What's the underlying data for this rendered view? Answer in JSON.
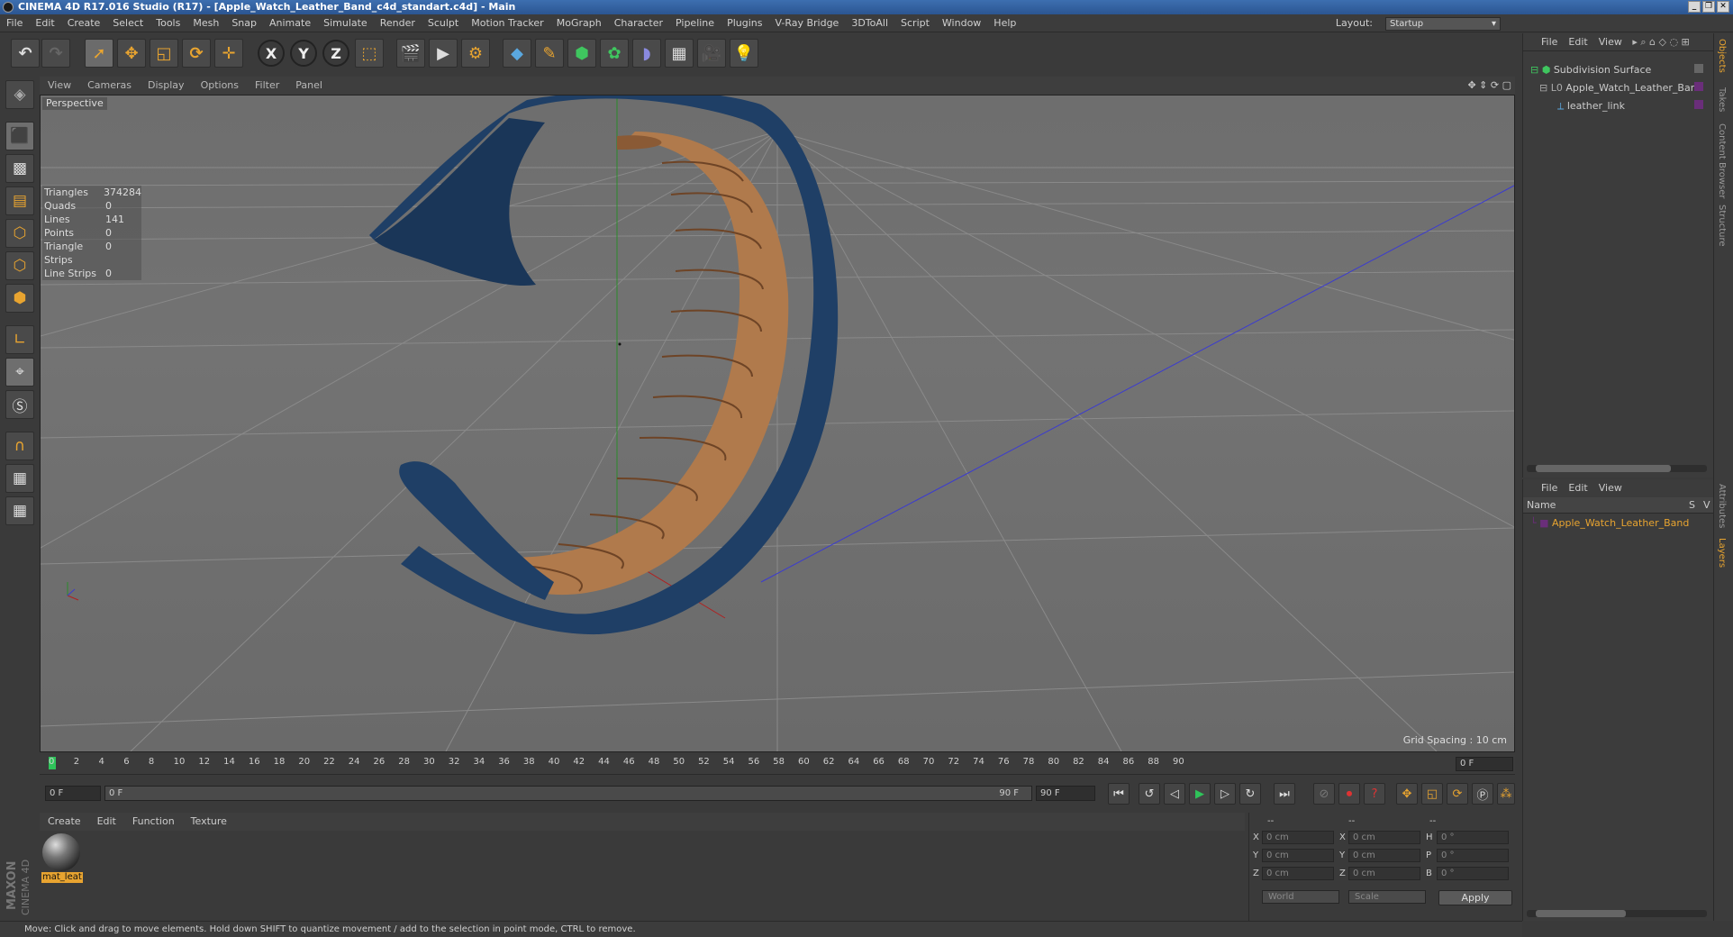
{
  "window": {
    "title": "CINEMA 4D R17.016 Studio (R17) - [Apple_Watch_Leather_Band_c4d_standart.c4d] - Main"
  },
  "menu": [
    "File",
    "Edit",
    "Create",
    "Select",
    "Tools",
    "Mesh",
    "Snap",
    "Animate",
    "Simulate",
    "Render",
    "Sculpt",
    "Motion Tracker",
    "MoGraph",
    "Character",
    "Pipeline",
    "Plugins",
    "V-Ray Bridge",
    "3DToAll",
    "Script",
    "Window",
    "Help"
  ],
  "layout": {
    "label": "Layout:",
    "value": "Startup"
  },
  "toolbar": {
    "x_label": "X",
    "y_label": "Y",
    "z_label": "Z"
  },
  "viewport": {
    "menu": [
      "View",
      "Cameras",
      "Display",
      "Options",
      "Filter",
      "Panel"
    ],
    "label": "Perspective",
    "grid_spacing": "Grid Spacing : 10 cm",
    "stats": [
      {
        "k": "Triangles",
        "v": "374284"
      },
      {
        "k": "Quads",
        "v": "0"
      },
      {
        "k": "Lines",
        "v": "141"
      },
      {
        "k": "Points",
        "v": "0"
      },
      {
        "k": "Triangle Strips",
        "v": "0"
      },
      {
        "k": "Line Strips",
        "v": "0"
      }
    ]
  },
  "timeline": {
    "ticks": [
      "0",
      "2",
      "4",
      "6",
      "8",
      "10",
      "12",
      "14",
      "16",
      "18",
      "20",
      "22",
      "24",
      "26",
      "28",
      "30",
      "32",
      "34",
      "36",
      "38",
      "40",
      "42",
      "44",
      "46",
      "48",
      "50",
      "52",
      "54",
      "56",
      "58",
      "60",
      "62",
      "64",
      "66",
      "68",
      "70",
      "72",
      "74",
      "76",
      "78",
      "80",
      "82",
      "84",
      "86",
      "88",
      "90"
    ],
    "current_frame": "0 F",
    "start_field": "0 F",
    "slider_start": "0 F",
    "slider_end": "90 F",
    "end_field": "90 F"
  },
  "materials": {
    "menu": [
      "Create",
      "Edit",
      "Function",
      "Texture"
    ],
    "items": [
      {
        "name": "mat_leat"
      }
    ]
  },
  "coords": {
    "headers": [
      "--",
      "--",
      "--"
    ],
    "rows": [
      {
        "a": "X",
        "av": "0 cm",
        "b": "X",
        "bv": "0 cm",
        "c": "H",
        "cv": "0 °"
      },
      {
        "a": "Y",
        "av": "0 cm",
        "b": "Y",
        "bv": "0 cm",
        "c": "P",
        "cv": "0 °"
      },
      {
        "a": "Z",
        "av": "0 cm",
        "b": "Z",
        "bv": "0 cm",
        "c": "B",
        "cv": "0 °"
      }
    ],
    "world": "World",
    "scale": "Scale",
    "apply": "Apply"
  },
  "status": "Move: Click and drag to move elements. Hold down SHIFT to quantize movement / add to the selection in point mode, CTRL to remove.",
  "objects": {
    "menu": [
      "File",
      "Edit",
      "View"
    ],
    "tree": [
      {
        "name": "Subdivision Surface"
      },
      {
        "name": "Apple_Watch_Leather_Band"
      },
      {
        "name": "leather_link"
      }
    ]
  },
  "layers": {
    "menu": [
      "File",
      "Edit",
      "View"
    ],
    "header": {
      "name": "Name",
      "s": "S",
      "v": "V"
    },
    "items": [
      {
        "name": "Apple_Watch_Leather_Band"
      }
    ]
  },
  "side_tabs": [
    "Objects",
    "Takes",
    "Content Browser",
    "Structure"
  ],
  "side_tabs_lower": [
    "Attributes",
    "Layers"
  ],
  "brand": {
    "line1": "MAXON",
    "line2": "CINEMA 4D"
  },
  "colors": {
    "accent": "#e8a430",
    "band_outer": "#1f3f66",
    "band_inner": "#b07a4c",
    "axis_blue": "#3b3bd0",
    "axis_green": "#2a8a2a",
    "axis_red": "#b02020"
  }
}
